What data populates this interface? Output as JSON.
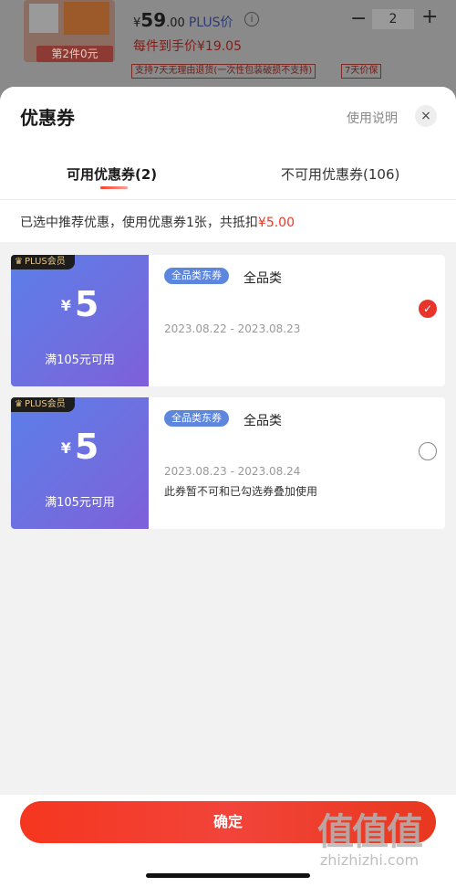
{
  "background": {
    "product_badge": "第2件0元",
    "price_symbol": "¥",
    "price_int": "59",
    "price_dec": ".00",
    "price_tag": "PLUS价",
    "info_icon": "i",
    "qty_minus": "−",
    "qty_value": "2",
    "qty_plus": "+",
    "each_price": "每件到手价¥19.05",
    "service_tag_1": "支持7天无理由退货(一次性包装破损不支持)",
    "service_tag_2": "7天价保"
  },
  "sheet": {
    "title": "优惠券",
    "help_link": "使用说明",
    "close_icon": "×",
    "tabs": [
      {
        "label": "可用优惠券(2)",
        "active": true
      },
      {
        "label": "不可用优惠券(106)",
        "active": false
      }
    ],
    "summary_prefix": "已选中推荐优惠，使用优惠券1张，共抵扣",
    "summary_amount": "¥5.00"
  },
  "coupons": [
    {
      "member_tag": "PLUS会员",
      "currency": "¥",
      "amount": "5",
      "threshold": "满105元可用",
      "type_label": "全品类东券",
      "scope": "全品类",
      "date_range": "2023.08.22 - 2023.08.23",
      "note": "",
      "checked": true
    },
    {
      "member_tag": "PLUS会员",
      "currency": "¥",
      "amount": "5",
      "threshold": "满105元可用",
      "type_label": "全品类东券",
      "scope": "全品类",
      "date_range": "2023.08.23 - 2023.08.24",
      "note": "此券暂不可和已勾选券叠加使用",
      "checked": false
    }
  ],
  "footer": {
    "confirm_label": "确定"
  },
  "watermark": {
    "big": "值值值",
    "small": "zhizhizhi.com"
  },
  "colors": {
    "accent_red": "#e8342b",
    "coupon_blue": "#5b7fe8",
    "coupon_purple": "#7f5fd9"
  }
}
